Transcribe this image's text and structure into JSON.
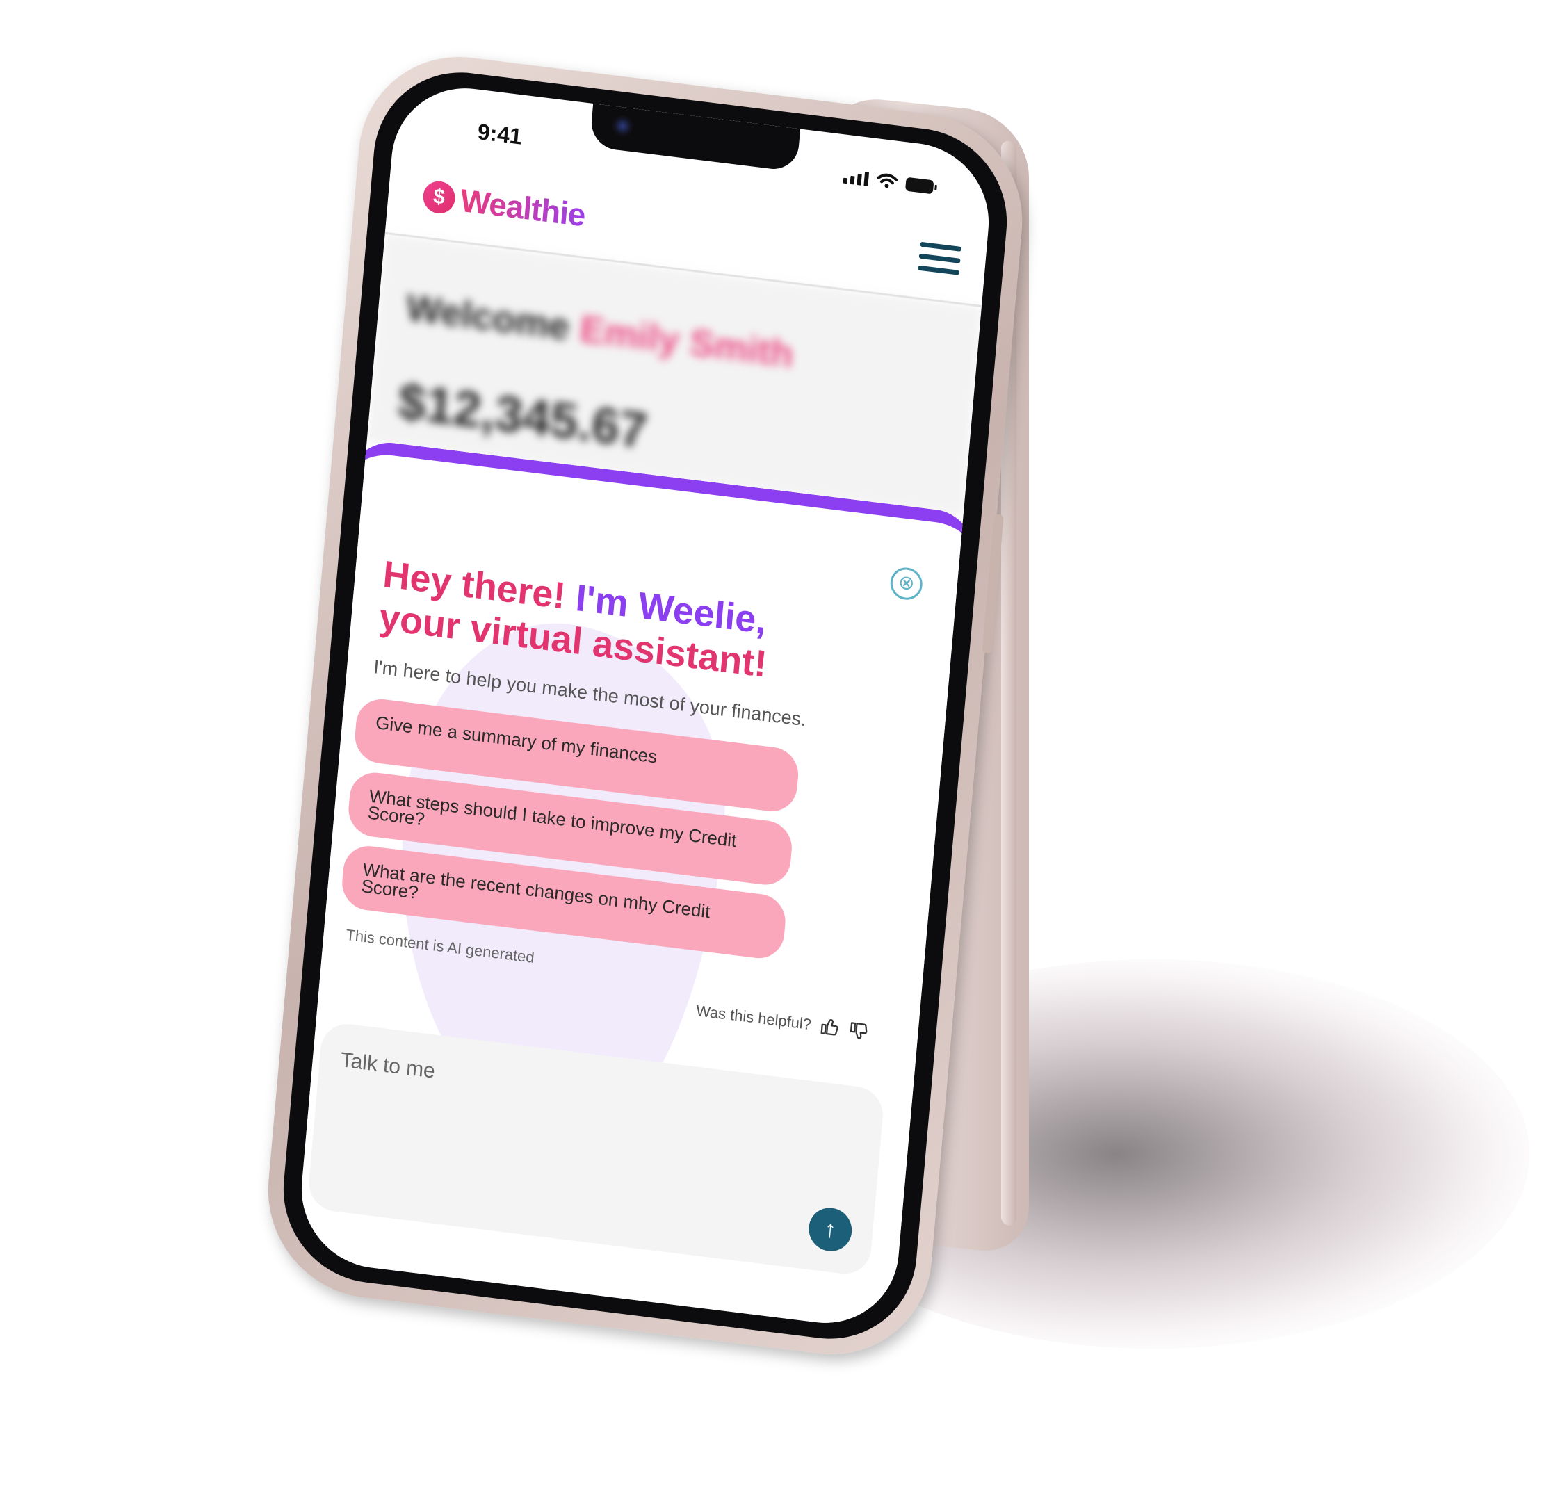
{
  "status": {
    "time": "9:41"
  },
  "app": {
    "name": "Wealthie",
    "logo_symbol": "$"
  },
  "dashboard": {
    "welcome_prefix": "Welcome",
    "user_name": "Emily Smith",
    "balance": "$12,345.67"
  },
  "assistant": {
    "headline_part1": "Hey there! ",
    "headline_accent": "I'm Weelie,",
    "headline_part2": " your virtual assistant!",
    "subline": "I'm here to help you make the most of your finances.",
    "suggestions": [
      "Give me a summary of my finances",
      "What steps should I take to improve my Credit Score?",
      "What are the recent changes on mhy Credit Score?"
    ],
    "ai_note": "This content is AI generated",
    "feedback_prompt": "Was this helpful?",
    "input_placeholder": "Talk to me",
    "close_symbol": "⊗",
    "send_symbol": "↑"
  },
  "colors": {
    "brand_pink": "#e2356f",
    "brand_purple": "#8b3ff0",
    "chip_pink": "#fba7bb",
    "send_button": "#1c5f78",
    "menu_icon": "#13465a"
  }
}
